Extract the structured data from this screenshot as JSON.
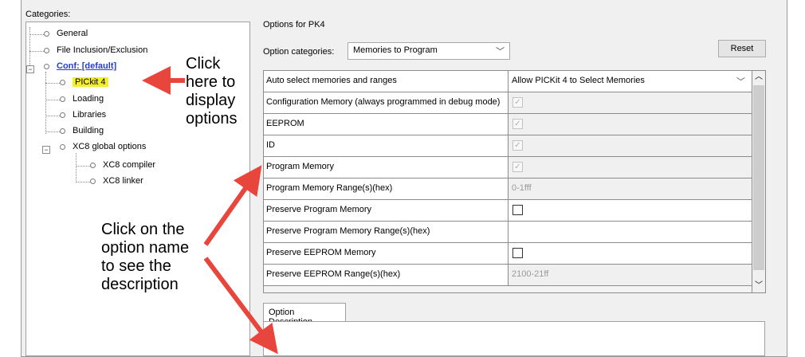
{
  "categories_label": "Categories:",
  "tree": {
    "general": "General",
    "file_inclusion": "File Inclusion/Exclusion",
    "conf": "Conf: [default]",
    "pickit": "PICkit 4",
    "loading": "Loading",
    "libraries": "Libraries",
    "building": "Building",
    "xc8_global": "XC8 global options",
    "xc8_compiler": "XC8 compiler",
    "xc8_linker": "XC8 linker"
  },
  "annotations": {
    "click_here": [
      "Click",
      "here to",
      "display",
      "options"
    ],
    "click_option": [
      "Click on the",
      "option name",
      "to see the",
      "description"
    ]
  },
  "options_title": "Options for PK4",
  "option_categories": {
    "label": "Option categories:",
    "selected": "Memories to Program"
  },
  "reset_label": "Reset",
  "grid_rows": [
    {
      "name": "Auto select memories and ranges",
      "value": "Allow PICKit 4 to Select Memories",
      "type": "dropdown"
    },
    {
      "name": "Configuration Memory (always programmed in debug mode)",
      "value": "",
      "type": "check-disabled",
      "checked": true
    },
    {
      "name": "EEPROM",
      "value": "",
      "type": "check-disabled",
      "checked": true
    },
    {
      "name": "ID",
      "value": "",
      "type": "check-disabled",
      "checked": true
    },
    {
      "name": "Program Memory",
      "value": "",
      "type": "check-disabled",
      "checked": true
    },
    {
      "name": "Program Memory Range(s)(hex)",
      "value": "0-1fff",
      "type": "text-disabled"
    },
    {
      "name": "Preserve Program Memory",
      "value": "",
      "type": "check",
      "checked": false
    },
    {
      "name": "Preserve Program Memory Range(s)(hex)",
      "value": "",
      "type": "text"
    },
    {
      "name": "Preserve EEPROM Memory",
      "value": "",
      "type": "check",
      "checked": false
    },
    {
      "name": "Preserve EEPROM Range(s)(hex)",
      "value": "2100-21ff",
      "type": "text-disabled"
    }
  ],
  "description_tab": "Option Description",
  "colors": {
    "highlight": "#f3ef2c",
    "arrow": "#e8453c",
    "link": "#1f3fd0"
  }
}
